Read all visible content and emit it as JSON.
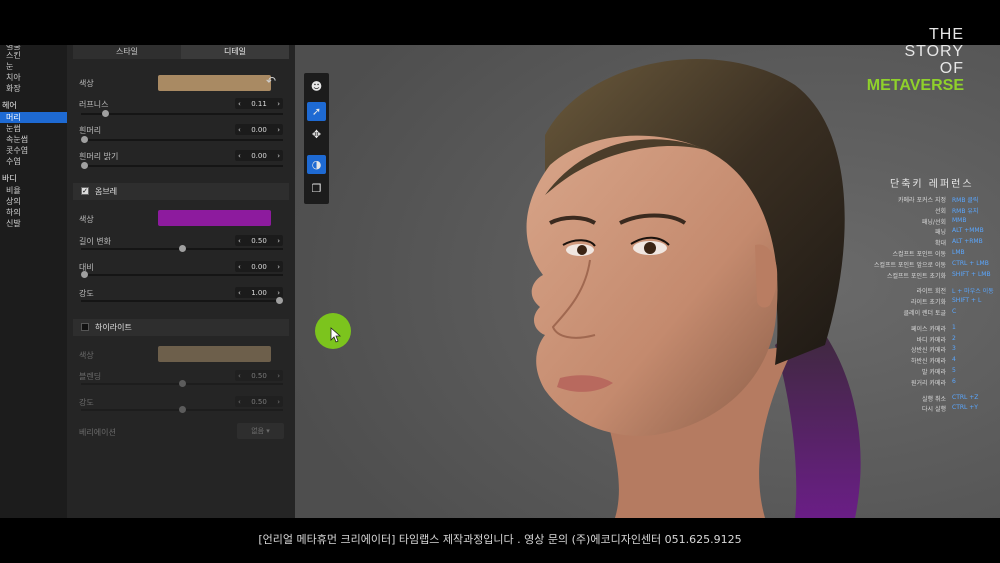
{
  "logo": {
    "line1": "THE",
    "line2": "STORY",
    "line3": "OF",
    "line4": "METAVERSE"
  },
  "caption": "[언리얼 메타휴먼 크리에이터] 타임랩스 제작과정입니다 . 영상 문의 (주)에코디자인센터 051.625.9125",
  "nav": {
    "face_items": [
      "얼굴",
      "스킨",
      "눈",
      "치아",
      "화장"
    ],
    "hair_head": "헤어",
    "hair_items": [
      "머리",
      "눈썹",
      "속눈썹",
      "콧수염",
      "수염"
    ],
    "body_head": "바디",
    "body_items": [
      "비율",
      "상의",
      "하의",
      "신발"
    ]
  },
  "panel": {
    "tab_style": "스타일",
    "tab_detail": "디테일",
    "color_label": "색상",
    "color_value": "#a98a63",
    "roughness_label": "러프니스",
    "roughness_value": "0.11",
    "roughness_level": 0.11,
    "gray_label": "흰머리",
    "gray_value": "0.00",
    "gray_level": 0.0,
    "gray_bright_label": "흰머리 밝기",
    "gray_bright_value": "0.00",
    "gray_bright_level": 0.0,
    "ombre_label": "옴브레",
    "ombre_color_label": "색상",
    "ombre_color_value": "#8d1b9e",
    "length_label": "길이 변화",
    "length_value": "0.50",
    "length_level": 0.5,
    "contrast_label": "대비",
    "contrast_value": "0.00",
    "contrast_level": 0.0,
    "intensity_label": "강도",
    "intensity_value": "1.00",
    "intensity_level": 1.0,
    "highlight_label": "하이라이트",
    "hl_color_label": "색상",
    "hl_color_value": "#c4a57a",
    "blend_label": "블렌딩",
    "blend_value": "0.50",
    "blend_level": 0.5,
    "hl_intensity_label": "강도",
    "hl_intensity_value": "0.50",
    "hl_intensity_level": 0.5,
    "variation_label": "베리에이션",
    "variation_value": "없음 ▾"
  },
  "toolbar": [
    "head-icon",
    "select-pointer-icon",
    "move-icon",
    "sculpt-icon",
    "copy-icon"
  ],
  "shortcuts": {
    "title": "단축키 레퍼런스",
    "rows": [
      [
        "카메라 포커스 지정",
        "RMB 클릭"
      ],
      [
        "선회",
        "RMB 유지"
      ],
      [
        "패닝/선회",
        "MMB"
      ],
      [
        "패닝",
        "ALT +MMB"
      ],
      [
        "확대",
        "ALT +RMB"
      ],
      [
        "스컬프트 포인트 이동",
        "LMB"
      ],
      [
        "스컬프트 포인트 앞으로 이동",
        "CTRL + LMB"
      ],
      [
        "스컬프트 포인트 초기화",
        "SHIFT + LMB"
      ],
      [
        "라이트 회전",
        "L + 마우스 이동"
      ],
      [
        "라이트 초기화",
        "SHIFT + L"
      ],
      [
        "클레이 렌더 토글",
        "C"
      ],
      [
        "페이스 카메라",
        "1"
      ],
      [
        "바디 카메라",
        "2"
      ],
      [
        "상반신 카메라",
        "3"
      ],
      [
        "하반신 카메라",
        "4"
      ],
      [
        "발 카메라",
        "5"
      ],
      [
        "원거리 카메라",
        "6"
      ],
      [
        "실행 취소",
        "CTRL +Z"
      ],
      [
        "다시 실행",
        "CTRL +Y"
      ]
    ]
  }
}
